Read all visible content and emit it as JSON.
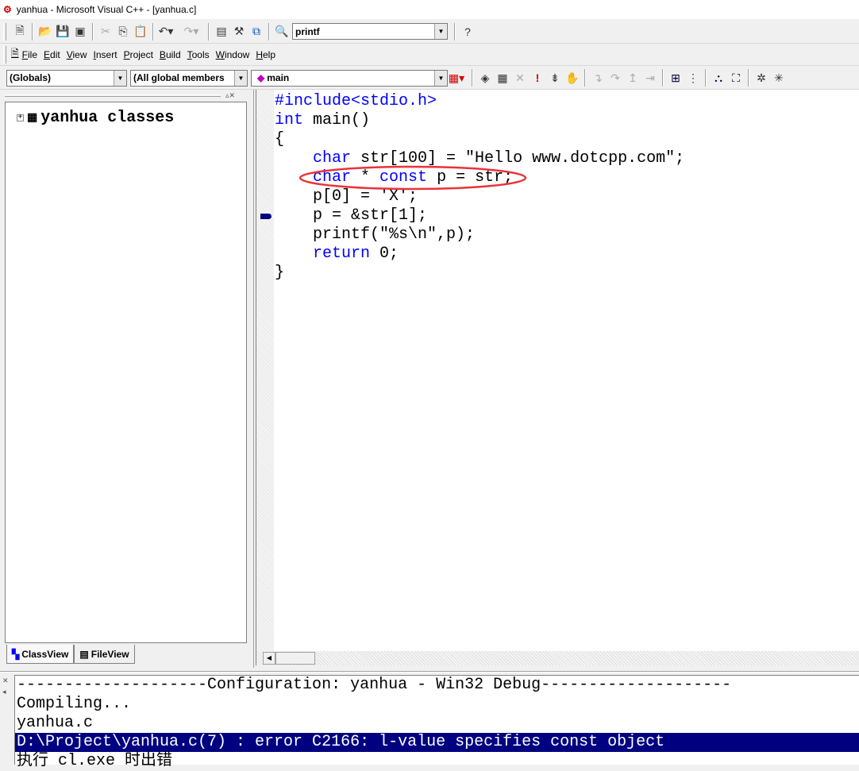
{
  "window": {
    "title": "yanhua - Microsoft Visual C++ - [yanhua.c]"
  },
  "toolbar": {
    "find_combo": "printf"
  },
  "menu": [
    "File",
    "Edit",
    "View",
    "Insert",
    "Project",
    "Build",
    "Tools",
    "Window",
    "Help"
  ],
  "wizardbar": {
    "scope": "(Globals)",
    "filter": "(All global members",
    "member": "main"
  },
  "workspace": {
    "tree_root": "yanhua classes",
    "tabs": [
      "ClassView",
      "FileView"
    ]
  },
  "editor": {
    "lines": [
      [
        [
          "kw",
          "#include<stdio.h>"
        ]
      ],
      [
        [
          "kw",
          "int"
        ],
        [
          "",
          " main()"
        ]
      ],
      [
        [
          "",
          "{"
        ]
      ],
      [
        [
          "",
          "    "
        ],
        [
          "kw",
          "char"
        ],
        [
          "",
          " str[100] = \"Hello www.dotcpp.com\";"
        ]
      ],
      [
        [
          "",
          "    "
        ],
        [
          "kw",
          "char"
        ],
        [
          "",
          " * "
        ],
        [
          "kw",
          "const"
        ],
        [
          "",
          " p = str;"
        ]
      ],
      [
        [
          "",
          "    p[0] = 'X';"
        ]
      ],
      [
        [
          "",
          "    p = &str[1];"
        ]
      ],
      [
        [
          "",
          "    printf(\"%s\\n\",p);"
        ]
      ],
      [
        [
          "",
          "    "
        ],
        [
          "kw",
          "return"
        ],
        [
          "",
          " 0;"
        ]
      ],
      [
        [
          "",
          "}"
        ]
      ]
    ],
    "current_line": 7,
    "highlight_color": "#e8333a"
  },
  "output": {
    "lines": [
      "--------------------Configuration: yanhua - Win32 Debug--------------------",
      "Compiling...",
      "yanhua.c",
      "D:\\Project\\yanhua.c(7) : error C2166: l-value specifies const object",
      "执行 cl.exe 时出错"
    ],
    "selected": 3
  }
}
